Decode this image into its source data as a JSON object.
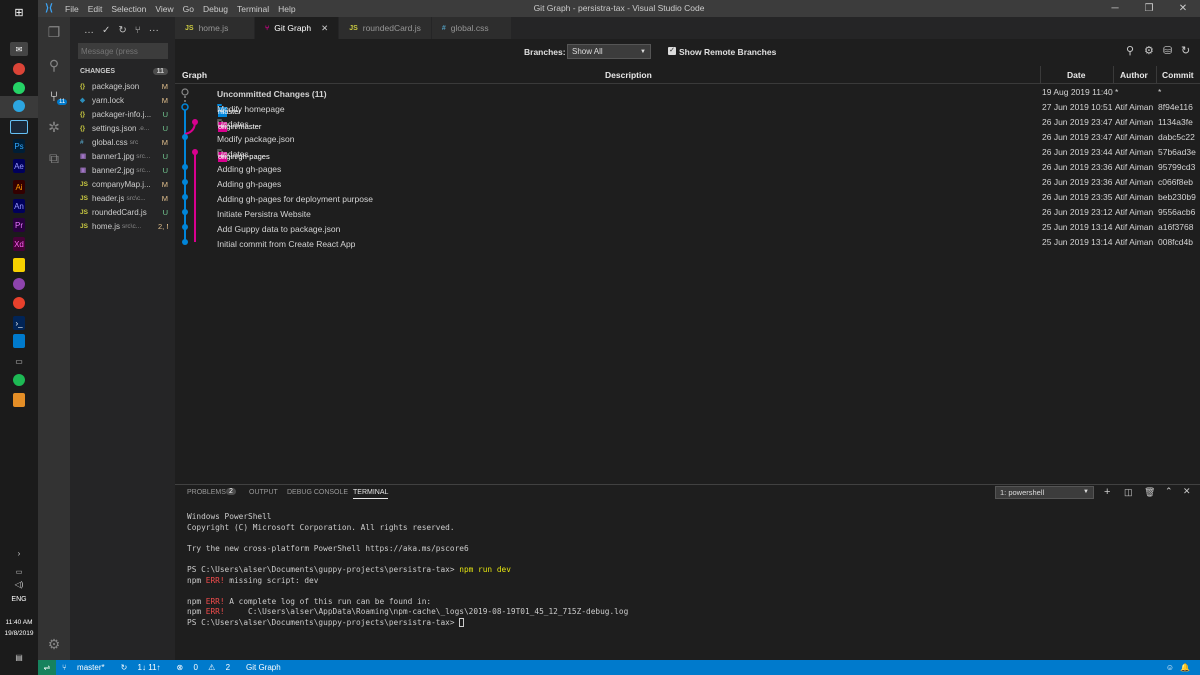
{
  "window": {
    "title": "Git Graph - persistra-tax - Visual Studio Code",
    "menu": [
      "File",
      "Edit",
      "Selection",
      "View",
      "Go",
      "Debug",
      "Terminal",
      "Help"
    ]
  },
  "taskbar": {
    "language": "ENG",
    "time": "11:40 AM",
    "date": "19/8/2019"
  },
  "source_control": {
    "commit_placeholder": "Message (press",
    "changes_label": "CHANGES",
    "changes_count": "11",
    "files": [
      {
        "icon": "{}",
        "name": "package.json",
        "path": "",
        "status": "M"
      },
      {
        "icon": "yarn",
        "name": "yarn.lock",
        "path": "",
        "status": "M"
      },
      {
        "icon": "{}",
        "name": "packager-info.j...",
        "path": "",
        "status": "U"
      },
      {
        "icon": "{}",
        "name": "settings.json",
        "path": ".e...",
        "status": "U"
      },
      {
        "icon": "#",
        "name": "global.css",
        "path": "src",
        "status": "M"
      },
      {
        "icon": "img",
        "name": "banner1.jpg",
        "path": "src...",
        "status": "U"
      },
      {
        "icon": "img",
        "name": "banner2.jpg",
        "path": "src...",
        "status": "U"
      },
      {
        "icon": "JS",
        "name": "companyMap.j...",
        "path": "",
        "status": "M"
      },
      {
        "icon": "JS",
        "name": "header.js",
        "path": "src\\c...",
        "status": "M"
      },
      {
        "icon": "JS",
        "name": "roundedCard.js",
        "path": "",
        "status": "U"
      },
      {
        "icon": "JS",
        "name": "home.js",
        "path": "src\\c...",
        "status": "2, M"
      }
    ]
  },
  "tabs": [
    {
      "icon": "JS",
      "label": "home.js"
    },
    {
      "icon": "git",
      "label": "Git Graph"
    },
    {
      "icon": "JS",
      "label": "roundedCard.js"
    },
    {
      "icon": "#",
      "label": "global.css"
    }
  ],
  "git_graph": {
    "branches_label": "Branches:",
    "branches_value": "Show All",
    "remote_label": "Show Remote Branches",
    "columns": {
      "graph": "Graph",
      "description": "Description",
      "date": "Date",
      "author": "Author",
      "commit": "Commit"
    },
    "rows": [
      {
        "ref": "",
        "desc": "Uncommitted Changes (11)",
        "date": "19 Aug 2019 11:40",
        "author": "*",
        "commit": "*"
      },
      {
        "ref": "master",
        "desc": "Modify homepage",
        "date": "27 Jun 2019 10:51",
        "author": "Atif Aiman",
        "commit": "8f94e116"
      },
      {
        "ref": "origin/master",
        "desc": "Updates",
        "date": "26 Jun 2019 23:47",
        "author": "Atif Aiman",
        "commit": "1134a3fe"
      },
      {
        "ref": "",
        "desc": "Modify package.json",
        "date": "26 Jun 2019 23:47",
        "author": "Atif Aiman",
        "commit": "dabc5c22"
      },
      {
        "ref": "origin/gh-pages",
        "desc": "Updates",
        "date": "26 Jun 2019 23:44",
        "author": "Atif Aiman",
        "commit": "57b6ad3e"
      },
      {
        "ref": "",
        "desc": "Adding gh-pages",
        "date": "26 Jun 2019 23:36",
        "author": "Atif Aiman",
        "commit": "95799cd3"
      },
      {
        "ref": "",
        "desc": "Adding gh-pages",
        "date": "26 Jun 2019 23:36",
        "author": "Atif Aiman",
        "commit": "c066f8eb"
      },
      {
        "ref": "",
        "desc": "Adding gh-pages for deployment purpose",
        "date": "26 Jun 2019 23:35",
        "author": "Atif Aiman",
        "commit": "beb230b9"
      },
      {
        "ref": "",
        "desc": "Initiate Persistra Website",
        "date": "26 Jun 2019 23:12",
        "author": "Atif Aiman",
        "commit": "9556acb6"
      },
      {
        "ref": "",
        "desc": "Add Guppy data to package.json",
        "date": "25 Jun 2019 13:14",
        "author": "Atif Aiman",
        "commit": "a16f3768"
      },
      {
        "ref": "",
        "desc": "Initial commit from Create React App",
        "date": "25 Jun 2019 13:14",
        "author": "Atif Aiman",
        "commit": "008fcd4b"
      }
    ]
  },
  "panel": {
    "tabs": [
      "PROBLEMS",
      "OUTPUT",
      "DEBUG CONSOLE",
      "TERMINAL"
    ],
    "problems_count": "2",
    "terminal_select": "1: powershell",
    "terminal": {
      "l1": "Windows PowerShell",
      "l2": "Copyright (C) Microsoft Corporation. All rights reserved.",
      "l3": "Try the new cross-platform PowerShell https://aka.ms/pscore6",
      "prompt": "PS C:\\Users\\alser\\Documents\\guppy-projects\\persistra-tax> ",
      "cmd": "npm run dev",
      "npm": "npm ",
      "err": "ERR!",
      "l5": " missing script: dev",
      "l6": " A complete log of this run can be found in:",
      "l7": "     C:\\Users\\alser\\AppData\\Roaming\\npm-cache\\_logs\\2019-08-19T01_45_12_715Z-debug.log"
    }
  },
  "statusbar": {
    "branch": "master*",
    "sync": "1↓ 11↑",
    "errors": "0",
    "warnings": "2",
    "gitgraph": "Git Graph"
  },
  "colors": {
    "accent": "#007acc",
    "graph_blue": "#0085d9",
    "graph_pink": "#d9008f"
  }
}
